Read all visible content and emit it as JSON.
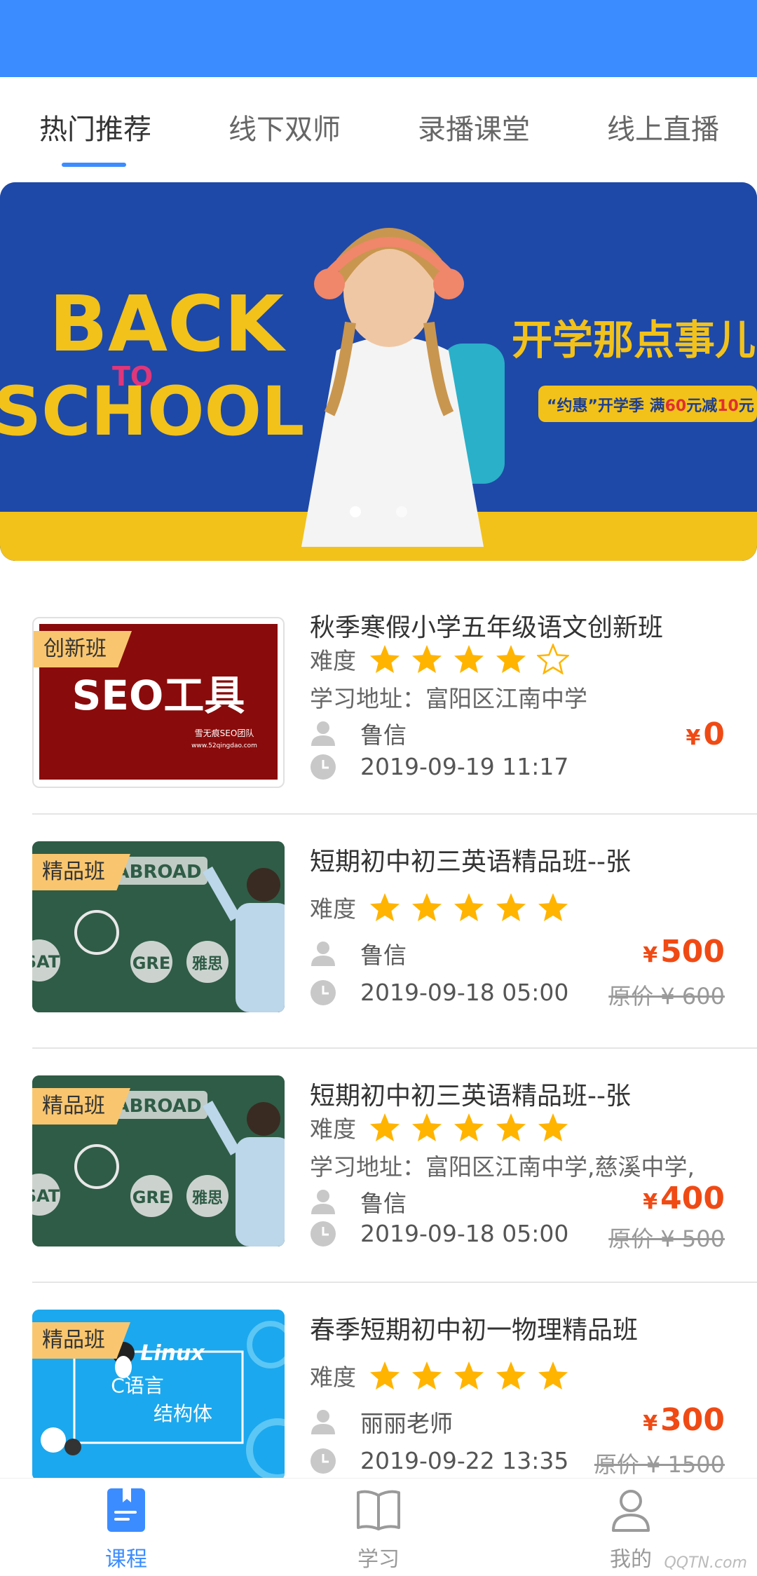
{
  "tabs": [
    {
      "label": "热门推荐",
      "active": true
    },
    {
      "label": "线下双师",
      "active": false
    },
    {
      "label": "录播课堂",
      "active": false
    },
    {
      "label": "线上直播",
      "active": false
    }
  ],
  "banner": {
    "headline_line1": "BACK",
    "headline_to": "TO",
    "headline_line2": "SCHOOL",
    "slogan": "开学那点事儿",
    "promo_parts": [
      "“约惠”开学季 满",
      "60",
      "元减",
      "10",
      "元"
    ],
    "dot_count": 2,
    "active_dot": 0
  },
  "labels": {
    "difficulty": "难度",
    "currency": "¥",
    "original_prefix": "原价"
  },
  "courses": [
    {
      "title": "秋季寒假小学五年级语文创新班",
      "tag": "创新班",
      "thumb_text": "SEO工具",
      "thumb_sub": "雪无痕SEO团队",
      "thumb_url_text": "www.52qingdao.com",
      "stars": 4,
      "address": "学习地址：富阳区江南中学",
      "teacher": "鲁信",
      "datetime": "2019-09-19 11:17",
      "price": "0",
      "original_price": ""
    },
    {
      "title": "短期初中初三英语精品班--张",
      "tag": "精品班",
      "thumb_words": [
        "ABROAD",
        "SAT",
        "GRE",
        "雅思"
      ],
      "stars": 5,
      "address": "",
      "teacher": "鲁信",
      "datetime": "2019-09-18 05:00",
      "price": "500",
      "original_price": "原价 ¥ 600"
    },
    {
      "title": "短期初中初三英语精品班--张",
      "tag": "精品班",
      "thumb_words": [
        "ABROAD",
        "SAT",
        "GRE",
        "雅思"
      ],
      "stars": 5,
      "address": "学习地址：富阳区江南中学,慈溪中学,",
      "teacher": "鲁信",
      "datetime": "2019-09-18 05:00",
      "price": "400",
      "original_price": "原价 ¥ 500"
    },
    {
      "title": "春季短期初中初一物理精品班",
      "tag": "精品班",
      "thumb_words": [
        "Linux",
        "C语言",
        "结构体"
      ],
      "stars": 5,
      "address": "",
      "teacher": "丽丽老师",
      "datetime": "2019-09-22 13:35",
      "price": "300",
      "original_price": "原价 ¥ 1500"
    }
  ],
  "bottom_nav": [
    {
      "label": "课程",
      "icon": "course-book-icon",
      "active": true
    },
    {
      "label": "学习",
      "icon": "open-book-icon",
      "active": false
    },
    {
      "label": "我的",
      "icon": "user-profile-icon",
      "active": false
    }
  ],
  "watermark": "QQTN.com",
  "colors": {
    "brand_blue": "#3b8cff",
    "price_red": "#f04a14",
    "star_yellow": "#ffb400",
    "tag_orange": "#f9c66f",
    "banner_blue": "#1e49a8",
    "banner_yellow": "#f2c21a"
  }
}
